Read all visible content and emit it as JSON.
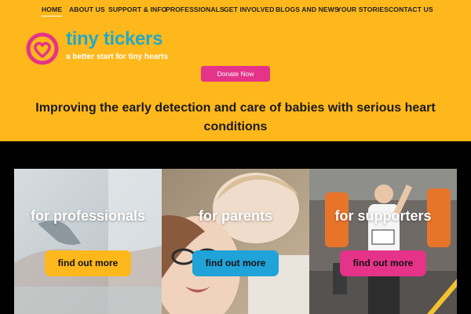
{
  "nav": {
    "items": [
      {
        "label": "HOME",
        "active": true
      },
      {
        "label": "ABOUT US"
      },
      {
        "label": "SUPPORT & INFO"
      },
      {
        "label": "PROFESSIONALS"
      },
      {
        "label": "GET INVOLVED"
      },
      {
        "label": "BLOGS AND NEWS"
      },
      {
        "label": "YOUR STORIES"
      },
      {
        "label": "CONTACT US"
      }
    ]
  },
  "brand": {
    "name": "tiny tickers",
    "tagline": "a better start for tiny hearts",
    "logo_icon": "heart-in-circle-icon",
    "colors": {
      "primary": "#24a9c4",
      "accent": "#e5338a",
      "background": "#ffb81c"
    }
  },
  "donate_label": "Donate Now",
  "headline": "Improving the early detection and care of babies with serious heart conditions",
  "cards": [
    {
      "title": "for professionals",
      "button": "find out more",
      "button_color": "#ffb81c"
    },
    {
      "title": "for parents",
      "button": "find out more",
      "button_color": "#1fa3d8"
    },
    {
      "title": "for supporters",
      "button": "find out more",
      "button_color": "#e5338a"
    }
  ]
}
